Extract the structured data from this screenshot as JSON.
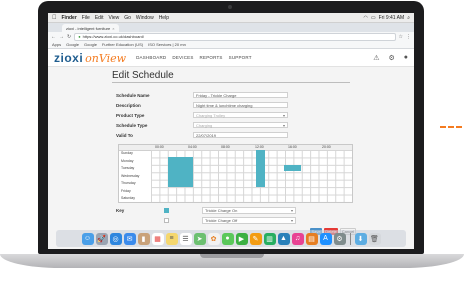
{
  "macos": {
    "apple_glyph": "",
    "app_name": "Finder",
    "menu": [
      "File",
      "Edit",
      "View",
      "Go",
      "Window",
      "Help"
    ],
    "clock": "Fri 9:41 AM"
  },
  "browser": {
    "tab_title": "zioxi - intelligent furniture",
    "url": "https://www.zioxi.co.uk/dashboard/",
    "bookmarks": [
      "Apps",
      "Google",
      "Google",
      "Further Education (US)",
      "ISO Services | 20 mn"
    ]
  },
  "app": {
    "logo_main": "zioxi",
    "logo_sub": "onView",
    "nav": [
      "DASHBOARD",
      "DEVICES",
      "REPORTS",
      "SUPPORT"
    ]
  },
  "page": {
    "title": "Edit Schedule",
    "fields": [
      {
        "label": "Schedule Name",
        "value": "Friday - Trickle Charge"
      },
      {
        "label": "Description",
        "value": "Night time & lunchtime charging"
      },
      {
        "label": "Product Type",
        "value": "Charging Trolley"
      },
      {
        "label": "Schedule Type",
        "value": "Charging"
      },
      {
        "label": "Valid To",
        "value": "22/07/2019"
      }
    ],
    "hours": [
      "00:00",
      "04:00",
      "08:00",
      "12:00",
      "16:00",
      "20:00"
    ],
    "days": [
      "Sunday",
      "Monday",
      "Tuesday",
      "Wednesday",
      "Thursday",
      "Friday",
      "Saturday"
    ],
    "key_label": "Key",
    "key_items": [
      "Trickle Charge On",
      "Trickle Charge Off"
    ],
    "buttons": {
      "save": "Save",
      "delete": "Delete",
      "cancel": "Cancel"
    }
  },
  "colors": {
    "brand_blue": "#1f5d8f",
    "brand_orange": "#f47b20",
    "schedule_on": "#4fb3c4",
    "delete_red": "#e53935",
    "save_blue": "#4a90c8"
  },
  "dock_icons": [
    "finder-icon",
    "launchpad-icon",
    "safari-icon",
    "mail-icon",
    "contacts-icon",
    "calendar-icon",
    "notes-icon",
    "reminders-icon",
    "maps-icon",
    "photos-icon",
    "messages-icon",
    "facetime-icon",
    "pages-icon",
    "numbers-icon",
    "keynote-icon",
    "itunes-icon",
    "ibooks-icon",
    "app-store-icon",
    "system-preferences-icon",
    "downloads-icon",
    "trash-icon"
  ]
}
